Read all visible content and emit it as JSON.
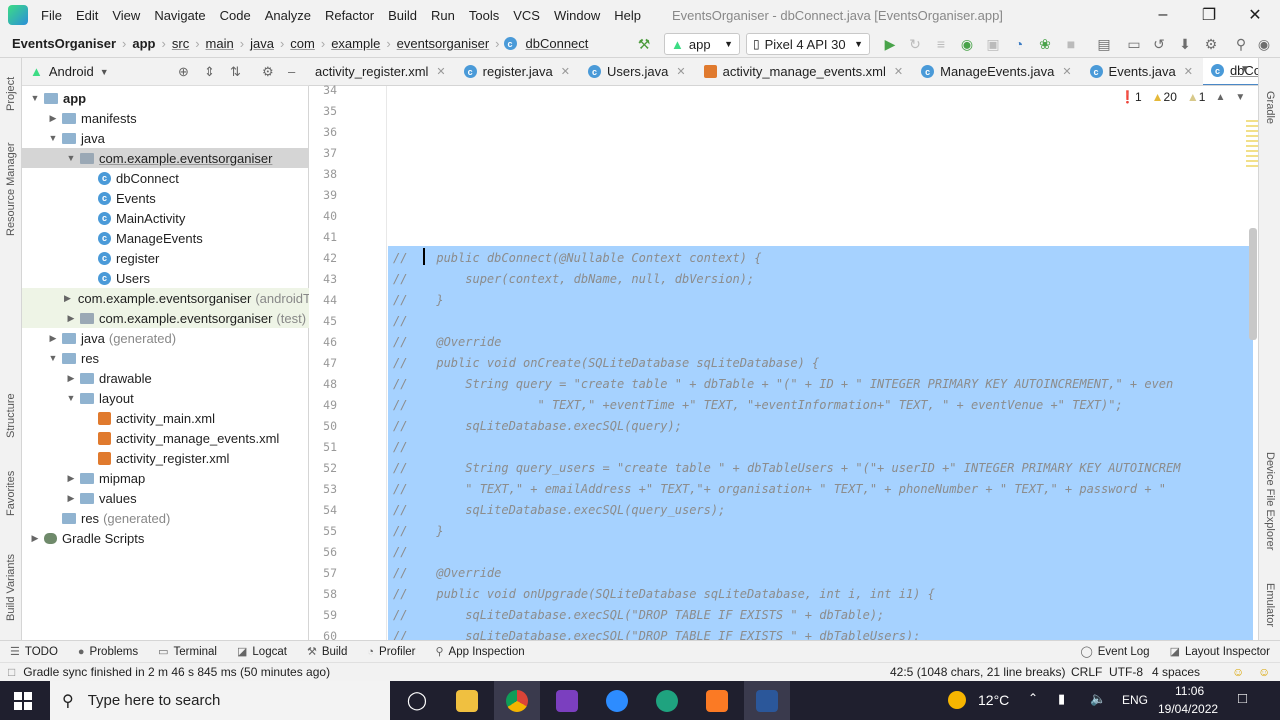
{
  "window": {
    "title": "EventsOrganiser - dbConnect.java [EventsOrganiser.app]",
    "menu": [
      "File",
      "Edit",
      "View",
      "Navigate",
      "Code",
      "Analyze",
      "Refactor",
      "Build",
      "Run",
      "Tools",
      "VCS",
      "Window",
      "Help"
    ]
  },
  "breadcrumb": [
    "EventsOrganiser",
    "app",
    "src",
    "main",
    "java",
    "com",
    "example",
    "eventsorganiser",
    "dbConnect"
  ],
  "toolbar": {
    "run_config": "app",
    "device": "Pixel 4 API 30"
  },
  "project_panel": {
    "view": "Android",
    "tree": [
      {
        "label": "app",
        "depth": 0,
        "kind": "folder",
        "expanded": true,
        "bold": true
      },
      {
        "label": "manifests",
        "depth": 1,
        "kind": "folder",
        "expanded": false
      },
      {
        "label": "java",
        "depth": 1,
        "kind": "folder",
        "expanded": true
      },
      {
        "label": "com.example.eventsorganiser",
        "depth": 2,
        "kind": "pkg",
        "expanded": true,
        "selected": true
      },
      {
        "label": "dbConnect",
        "depth": 3,
        "kind": "class"
      },
      {
        "label": "Events",
        "depth": 3,
        "kind": "class"
      },
      {
        "label": "MainActivity",
        "depth": 3,
        "kind": "class"
      },
      {
        "label": "ManageEvents",
        "depth": 3,
        "kind": "class"
      },
      {
        "label": "register",
        "depth": 3,
        "kind": "class"
      },
      {
        "label": "Users",
        "depth": 3,
        "kind": "class"
      },
      {
        "label": "com.example.eventsorganiser",
        "suffix": "(androidT",
        "depth": 2,
        "kind": "pkg",
        "expanded": false,
        "green": true
      },
      {
        "label": "com.example.eventsorganiser",
        "suffix": "(test)",
        "depth": 2,
        "kind": "pkg",
        "expanded": false,
        "green": true
      },
      {
        "label": "java",
        "suffix": "(generated)",
        "depth": 1,
        "kind": "folder",
        "expanded": false
      },
      {
        "label": "res",
        "depth": 1,
        "kind": "folder",
        "expanded": true
      },
      {
        "label": "drawable",
        "depth": 2,
        "kind": "folder",
        "expanded": false
      },
      {
        "label": "layout",
        "depth": 2,
        "kind": "folder",
        "expanded": true
      },
      {
        "label": "activity_main.xml",
        "depth": 3,
        "kind": "xml"
      },
      {
        "label": "activity_manage_events.xml",
        "depth": 3,
        "kind": "xml"
      },
      {
        "label": "activity_register.xml",
        "depth": 3,
        "kind": "xml"
      },
      {
        "label": "mipmap",
        "depth": 2,
        "kind": "folder",
        "expanded": false
      },
      {
        "label": "values",
        "depth": 2,
        "kind": "folder",
        "expanded": false
      },
      {
        "label": "res",
        "suffix": "(generated)",
        "depth": 1,
        "kind": "folder",
        "expanded": null
      },
      {
        "label": "Gradle Scripts",
        "depth": 0,
        "kind": "gradle",
        "expanded": false
      }
    ]
  },
  "left_strip": [
    "Project",
    "Resource Manager",
    "Structure",
    "Favorites",
    "Build Variants"
  ],
  "right_strip": [
    "Gradle",
    "Device File Explorer",
    "Emulator"
  ],
  "tabs": [
    {
      "label": "activity_register.xml",
      "kind": "xml"
    },
    {
      "label": "register.java",
      "kind": "class"
    },
    {
      "label": "Users.java",
      "kind": "class"
    },
    {
      "label": "activity_manage_events.xml",
      "kind": "xml"
    },
    {
      "label": "ManageEvents.java",
      "kind": "class"
    },
    {
      "label": "Events.java",
      "kind": "class"
    },
    {
      "label": "dbConnect.java",
      "kind": "class",
      "active": true
    }
  ],
  "inspections": {
    "errors": "1",
    "warnings": "20",
    "weak": "1"
  },
  "editor": {
    "first_line": 34,
    "lines": [
      "",
      "",
      "",
      "",
      "",
      "",
      "",
      "",
      "//    public dbConnect(@Nullable Context context) {",
      "//        super(context, dbName, null, dbVersion);",
      "//    }",
      "//",
      "//    @Override",
      "//    public void onCreate(SQLiteDatabase sqLiteDatabase) {",
      "//        String query = \"create table \" + dbTable + \"(\" + ID + \" INTEGER PRIMARY KEY AUTOINCREMENT,\" + even",
      "//                  \" TEXT,\" +eventTime +\" TEXT, \"+eventInformation+\" TEXT, \" + eventVenue +\" TEXT)\";",
      "//        sqLiteDatabase.execSQL(query);",
      "//",
      "//        String query_users = \"create table \" + dbTableUsers + \"(\"+ userID +\" INTEGER PRIMARY KEY AUTOINCREM",
      "//        \" TEXT,\" + emailAddress +\" TEXT,\"+ organisation+ \" TEXT,\" + phoneNumber + \" TEXT,\" + password + \"",
      "//        sqLiteDatabase.execSQL(query_users);",
      "//    }",
      "//",
      "//    @Override",
      "//    public void onUpgrade(SQLiteDatabase sqLiteDatabase, int i, int i1) {",
      "//        sqLiteDatabase.execSQL(\"DROP TABLE IF EXISTS \" + dbTable);",
      "//        sqLiteDatabase.execSQL(\"DROP TABLE IF EXISTS \" + dbTableUsers);"
    ]
  },
  "bottom_tools": [
    "TODO",
    "Problems",
    "Terminal",
    "Logcat",
    "Build",
    "Profiler",
    "App Inspection"
  ],
  "bottom_tools_right": [
    "Event Log",
    "Layout Inspector"
  ],
  "status": {
    "message": "Gradle sync finished in 2 m 46 s 845 ms (50 minutes ago)",
    "position": "42:5 (1048 chars, 21 line breaks)",
    "line_sep": "CRLF",
    "encoding": "UTF-8",
    "indent": "4 spaces"
  },
  "taskbar": {
    "search_placeholder": "Type here to search",
    "temperature": "12°C",
    "language": "ENG",
    "time": "11:06",
    "date": "19/04/2022"
  }
}
